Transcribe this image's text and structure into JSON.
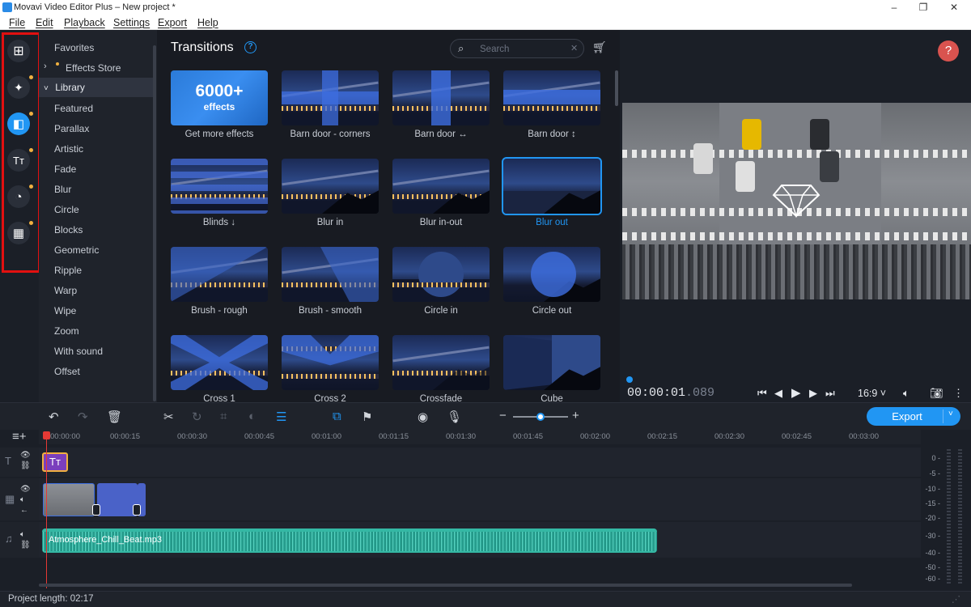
{
  "window": {
    "title": "Movavi Video Editor Plus – New project *",
    "minimize": "–",
    "maximize": "❐",
    "close": "✕"
  },
  "menu": [
    "File",
    "Edit",
    "Playback",
    "Settings",
    "Export",
    "Help"
  ],
  "rail": [
    {
      "icon": "import-icon",
      "glyph": "⊞"
    },
    {
      "icon": "magic-wand-icon",
      "glyph": "✦"
    },
    {
      "icon": "transitions-icon",
      "glyph": "◧"
    },
    {
      "icon": "titles-icon",
      "glyph": "Tт"
    },
    {
      "icon": "stickers-icon",
      "glyph": "◔"
    },
    {
      "icon": "more-tools-icon",
      "glyph": "▦"
    }
  ],
  "categories": {
    "favorites": "Favorites",
    "effects_store": "Effects Store",
    "library": "Library",
    "items": [
      "Featured",
      "Parallax",
      "Artistic",
      "Fade",
      "Blur",
      "Circle",
      "Blocks",
      "Geometric",
      "Ripple",
      "Warp",
      "Wipe",
      "Zoom",
      "With sound",
      "Offset"
    ]
  },
  "transitions": {
    "heading": "Transitions",
    "help": "?",
    "search_placeholder": "Search",
    "promo": {
      "line1": "6000+",
      "line2": "effects"
    },
    "tiles": [
      "Get more effects",
      "Barn door - corners",
      "Barn door ↔",
      "Barn door ↕",
      "Blinds ↓",
      "Blur in",
      "Blur in-out",
      "Blur out",
      "Brush - rough",
      "Brush - smooth",
      "Circle in",
      "Circle out",
      "Cross 1",
      "Cross 2",
      "Crossfade",
      "Cube"
    ],
    "selected": "Blur out"
  },
  "preview": {
    "help": "?",
    "timecode_main": "00:00:01",
    "timecode_ms": ".089",
    "aspect": "16:9 ˅"
  },
  "toolbar": {
    "export": "Export",
    "minus": "−",
    "plus": "+"
  },
  "ruler": [
    "00:00:00",
    "00:00:15",
    "00:00:30",
    "00:00:45",
    "00:01:00",
    "00:01:15",
    "00:01:30",
    "00:01:45",
    "00:02:00",
    "00:02:15",
    "00:02:30",
    "00:02:45",
    "00:03:00"
  ],
  "audio_clip": "Atmosphere_Chill_Beat.mp3",
  "meter_labels": [
    "0 -",
    "-5 -",
    "-10 -",
    "-15 -",
    "-20 -",
    "-30 -",
    "-40 -",
    "-50 -",
    "-60 -"
  ],
  "status": {
    "project_length": "Project length: 02:17"
  }
}
